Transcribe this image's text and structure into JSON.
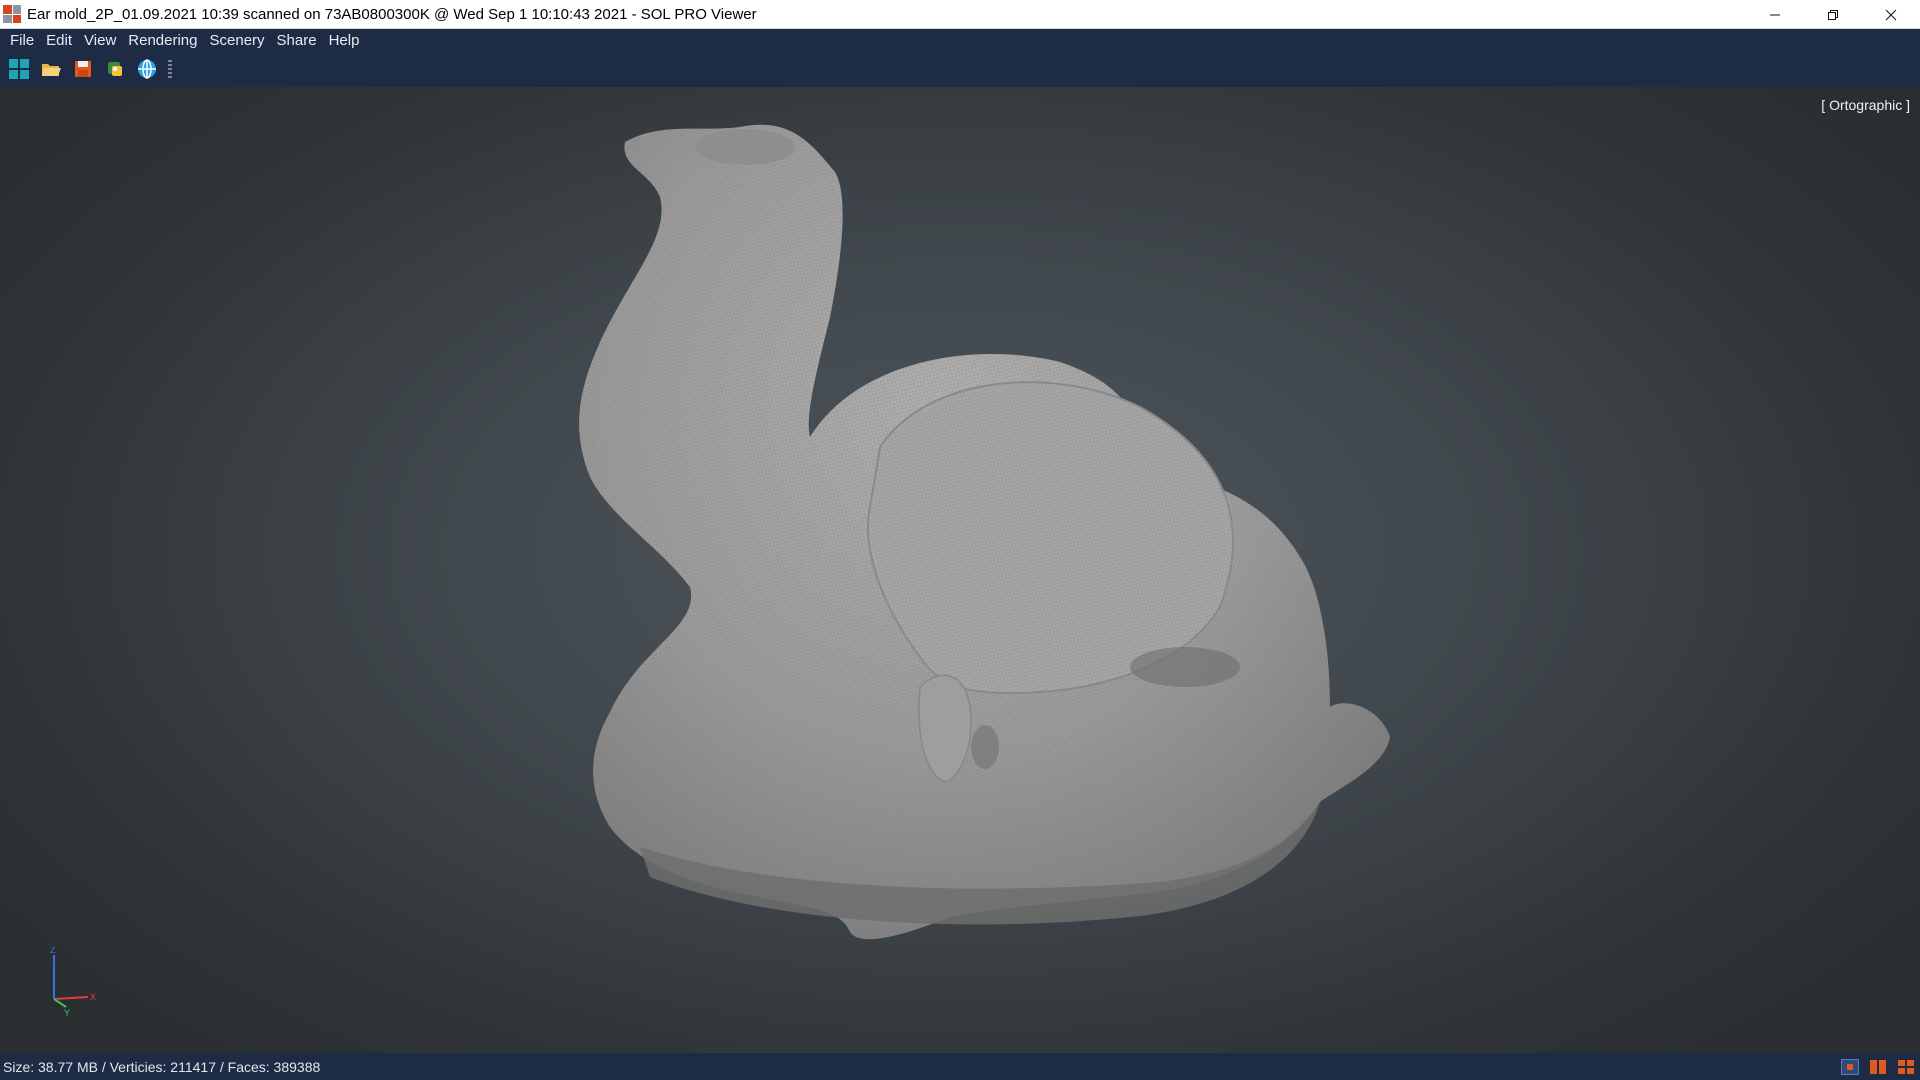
{
  "window": {
    "title": "Ear mold_2P_01.09.2021 10:39 scanned on 73AB0800300K @ Wed Sep 1 10:10:43 2021 - SOL PRO Viewer",
    "controls": [
      "minimize-icon",
      "restore-icon",
      "close-icon"
    ]
  },
  "menu": {
    "items": [
      {
        "label": "File"
      },
      {
        "label": "Edit"
      },
      {
        "label": "View"
      },
      {
        "label": "Rendering"
      },
      {
        "label": "Scenery"
      },
      {
        "label": "Share"
      },
      {
        "label": "Help"
      }
    ]
  },
  "toolbar": {
    "buttons": [
      {
        "icon": "grid-view-icon"
      },
      {
        "icon": "open-folder-icon"
      },
      {
        "icon": "save-icon"
      },
      {
        "icon": "plugin-icon"
      },
      {
        "icon": "globe-icon"
      }
    ]
  },
  "viewport": {
    "projection_label": "[ Ortographic ]",
    "axis": {
      "z": "Z",
      "x": "X",
      "y": "Y"
    }
  },
  "status": {
    "text": "Size: 38.77 MB / Verticies: 211417 / Faces: 389388",
    "icons": [
      "single-view-icon",
      "split-view-icon",
      "quad-view-icon"
    ]
  },
  "colors": {
    "chrome": "#1e2b45",
    "accent_orange": "#e05a1e",
    "model_gray": "#9a9a9a"
  }
}
